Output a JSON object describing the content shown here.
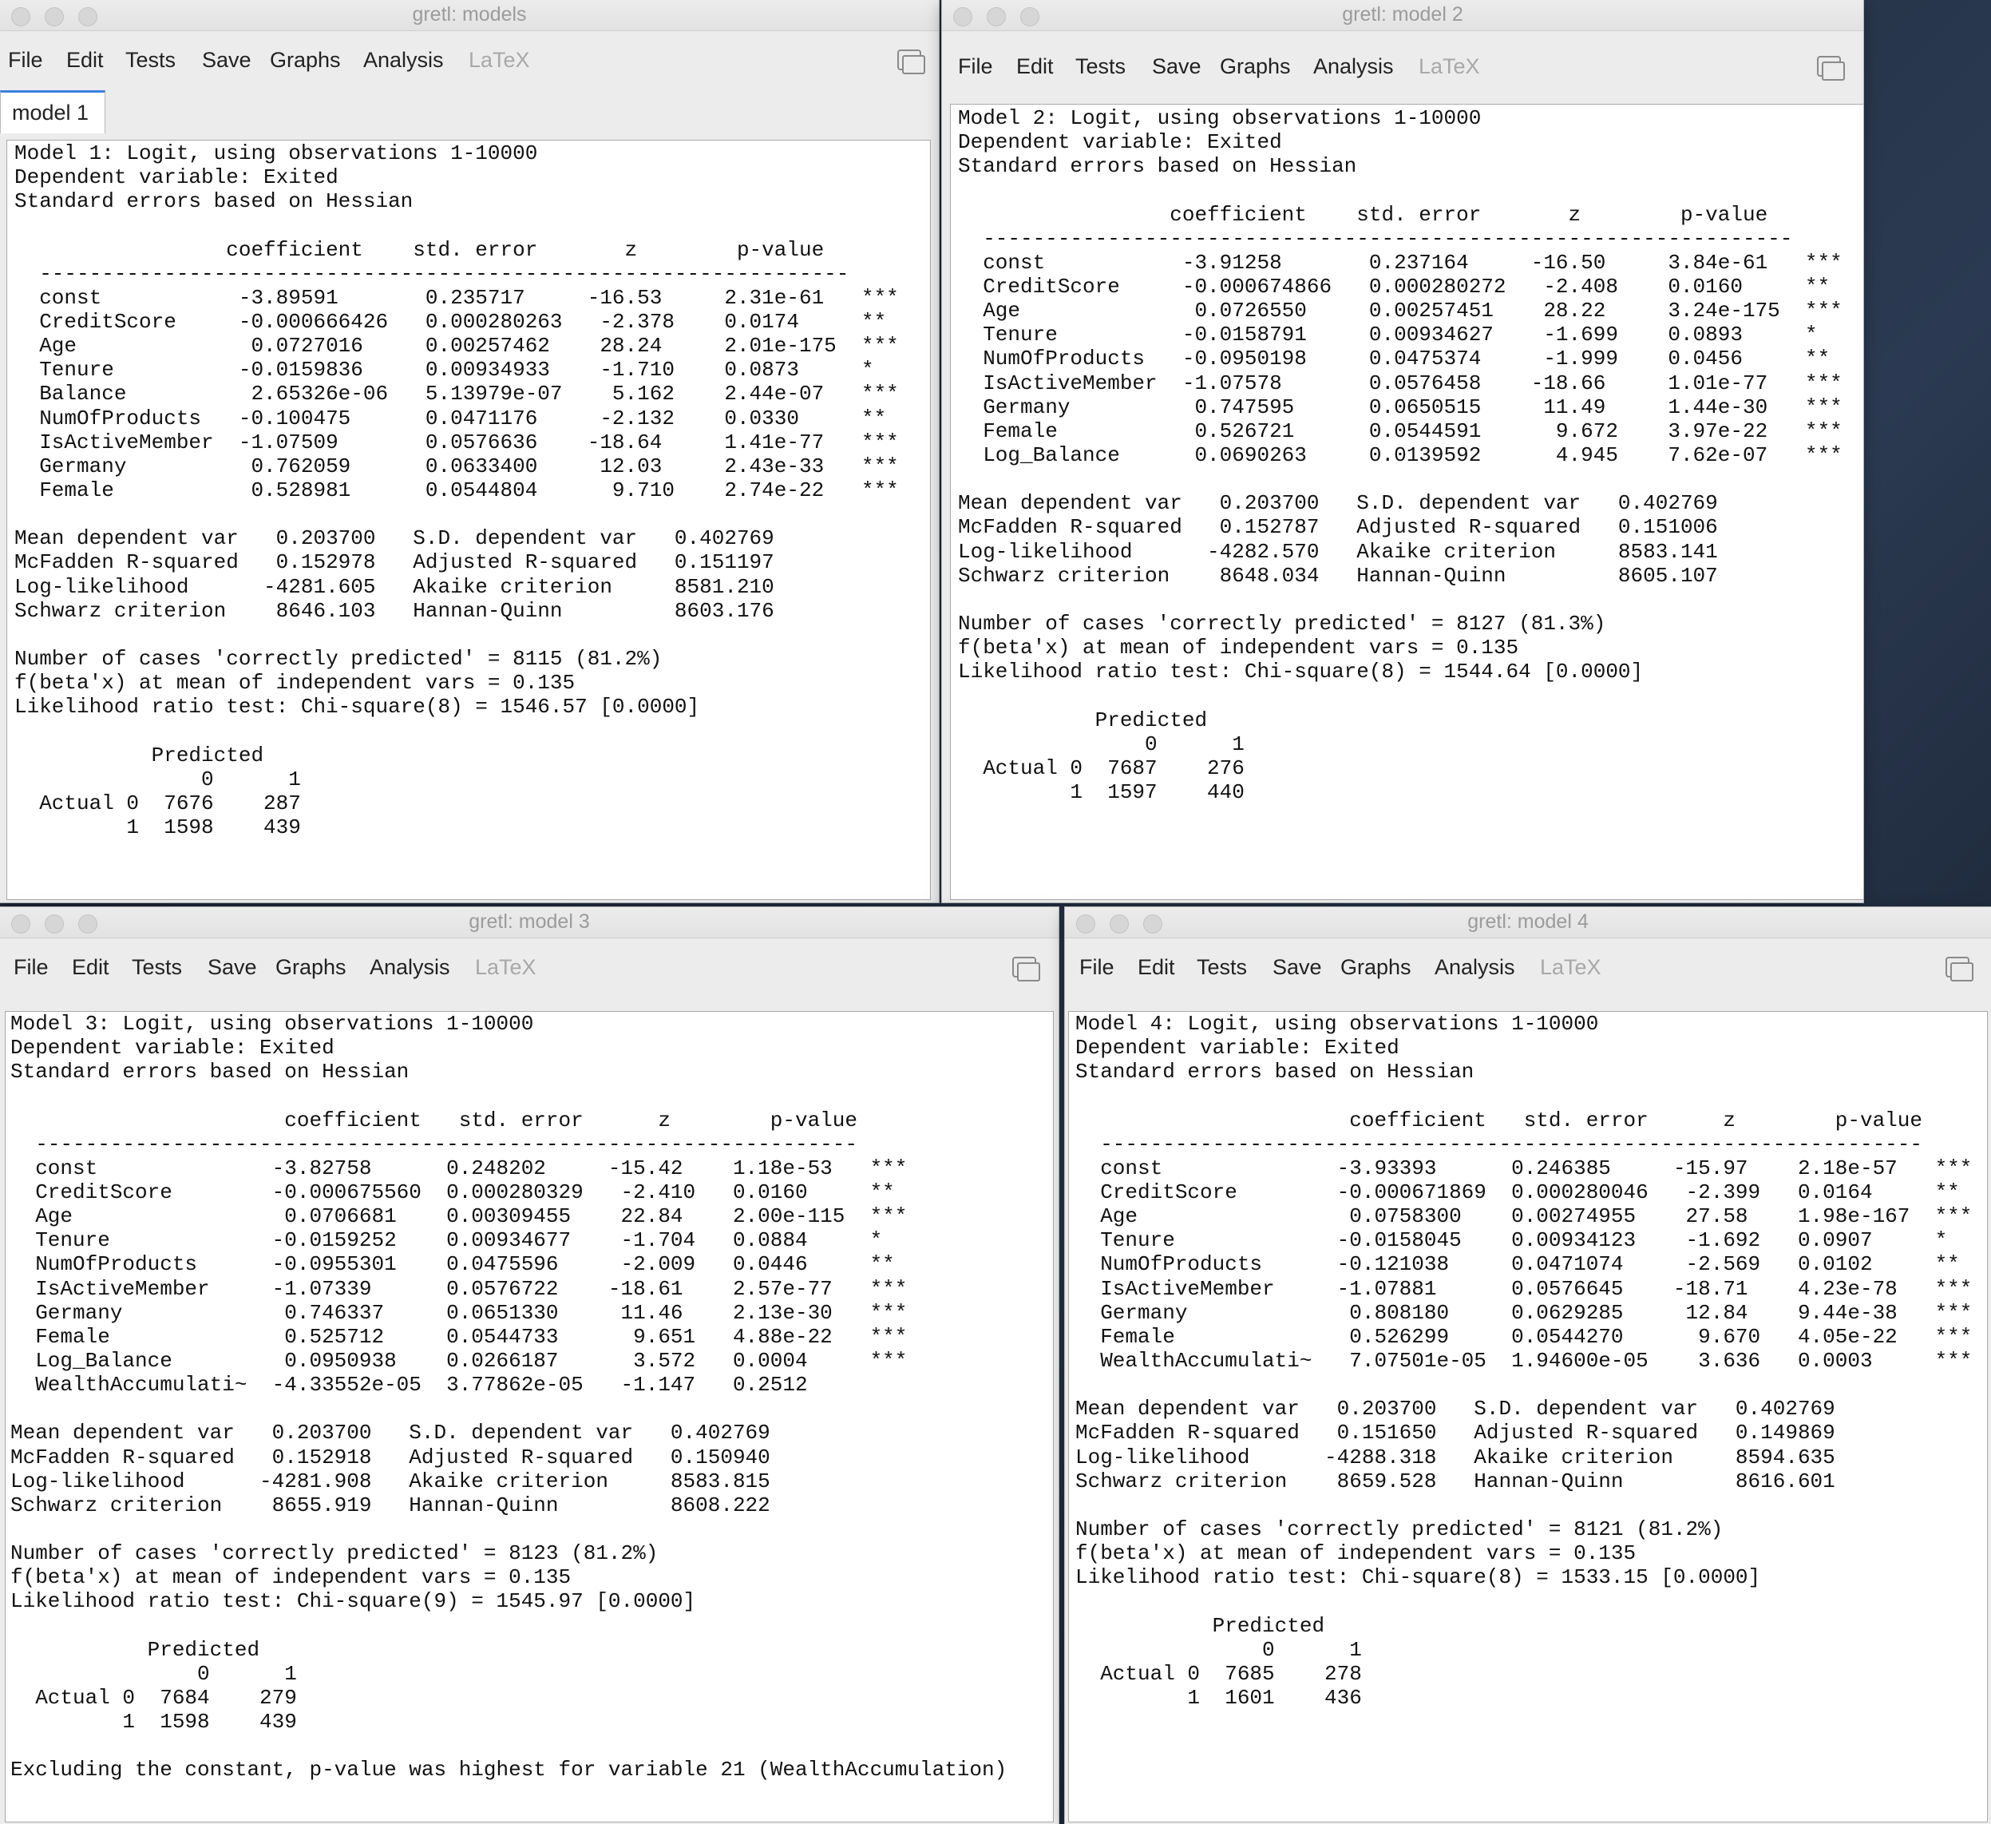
{
  "windows": [
    {
      "title": "gretl: models",
      "menu": [
        "File",
        "Edit",
        "Tests",
        "Save",
        "Graphs",
        "Analysis",
        "LaTeX"
      ],
      "tab": "model 1",
      "lines": [
        "Model 1: Logit, using observations 1-10000",
        "Dependent variable: Exited",
        "Standard errors based on Hessian",
        "",
        "                 coefficient    std. error       z        p-value",
        "  -----------------------------------------------------------------",
        "  const           -3.89591       0.235717     -16.53     2.31e-61   ***",
        "  CreditScore     -0.000666426   0.000280263   -2.378    0.0174     **",
        "  Age              0.0727016     0.00257462    28.24     2.01e-175  ***",
        "  Tenure          -0.0159836     0.00934933    -1.710    0.0873     *",
        "  Balance          2.65326e-06   5.13979e-07    5.162    2.44e-07   ***",
        "  NumOfProducts   -0.100475      0.0471176     -2.132    0.0330     **",
        "  IsActiveMember  -1.07509       0.0576636    -18.64     1.41e-77   ***",
        "  Germany          0.762059      0.0633400     12.03     2.43e-33   ***",
        "  Female           0.528981      0.0544804      9.710    2.74e-22   ***",
        "",
        "Mean dependent var   0.203700   S.D. dependent var   0.402769",
        "McFadden R-squared   0.152978   Adjusted R-squared   0.151197",
        "Log-likelihood      -4281.605   Akaike criterion     8581.210",
        "Schwarz criterion    8646.103   Hannan-Quinn         8603.176",
        "",
        "Number of cases 'correctly predicted' = 8115 (81.2%)",
        "f(beta'x) at mean of independent vars = 0.135",
        "Likelihood ratio test: Chi-square(8) = 1546.57 [0.0000]",
        "",
        "           Predicted",
        "               0      1",
        "  Actual 0  7676    287",
        "         1  1598    439"
      ]
    },
    {
      "title": "gretl: model 2",
      "menu": [
        "File",
        "Edit",
        "Tests",
        "Save",
        "Graphs",
        "Analysis",
        "LaTeX"
      ],
      "lines": [
        "Model 2: Logit, using observations 1-10000",
        "Dependent variable: Exited",
        "Standard errors based on Hessian",
        "",
        "                 coefficient    std. error       z        p-value",
        "  -----------------------------------------------------------------",
        "  const           -3.91258       0.237164     -16.50     3.84e-61   ***",
        "  CreditScore     -0.000674866   0.000280272   -2.408    0.0160     **",
        "  Age              0.0726550     0.00257451    28.22     3.24e-175  ***",
        "  Tenure          -0.0158791     0.00934627    -1.699    0.0893     *",
        "  NumOfProducts   -0.0950198     0.0475374     -1.999    0.0456     **",
        "  IsActiveMember  -1.07578       0.0576458    -18.66     1.01e-77   ***",
        "  Germany          0.747595      0.0650515     11.49     1.44e-30   ***",
        "  Female           0.526721      0.0544591      9.672    3.97e-22   ***",
        "  Log_Balance      0.0690263     0.0139592      4.945    7.62e-07   ***",
        "",
        "Mean dependent var   0.203700   S.D. dependent var   0.402769",
        "McFadden R-squared   0.152787   Adjusted R-squared   0.151006",
        "Log-likelihood      -4282.570   Akaike criterion     8583.141",
        "Schwarz criterion    8648.034   Hannan-Quinn         8605.107",
        "",
        "Number of cases 'correctly predicted' = 8127 (81.3%)",
        "f(beta'x) at mean of independent vars = 0.135",
        "Likelihood ratio test: Chi-square(8) = 1544.64 [0.0000]",
        "",
        "           Predicted",
        "               0      1",
        "  Actual 0  7687    276",
        "         1  1597    440"
      ]
    },
    {
      "title": "gretl: model 3",
      "menu": [
        "File",
        "Edit",
        "Tests",
        "Save",
        "Graphs",
        "Analysis",
        "LaTeX"
      ],
      "lines": [
        "Model 3: Logit, using observations 1-10000",
        "Dependent variable: Exited",
        "Standard errors based on Hessian",
        "",
        "                      coefficient   std. error      z        p-value",
        "  ------------------------------------------------------------------",
        "  const              -3.82758      0.248202     -15.42    1.18e-53   ***",
        "  CreditScore        -0.000675560  0.000280329   -2.410   0.0160     **",
        "  Age                 0.0706681    0.00309455    22.84    2.00e-115  ***",
        "  Tenure             -0.0159252    0.00934677    -1.704   0.0884     *",
        "  NumOfProducts      -0.0955301    0.0475596     -2.009   0.0446     **",
        "  IsActiveMember     -1.07339      0.0576722    -18.61    2.57e-77   ***",
        "  Germany             0.746337     0.0651330     11.46    2.13e-30   ***",
        "  Female              0.525712     0.0544733      9.651   4.88e-22   ***",
        "  Log_Balance         0.0950938    0.0266187      3.572   0.0004     ***",
        "  WealthAccumulati~  -4.33552e-05  3.77862e-05   -1.147   0.2512",
        "",
        "Mean dependent var   0.203700   S.D. dependent var   0.402769",
        "McFadden R-squared   0.152918   Adjusted R-squared   0.150940",
        "Log-likelihood      -4281.908   Akaike criterion     8583.815",
        "Schwarz criterion    8655.919   Hannan-Quinn         8608.222",
        "",
        "Number of cases 'correctly predicted' = 8123 (81.2%)",
        "f(beta'x) at mean of independent vars = 0.135",
        "Likelihood ratio test: Chi-square(9) = 1545.97 [0.0000]",
        "",
        "           Predicted",
        "               0      1",
        "  Actual 0  7684    279",
        "         1  1598    439",
        "",
        "Excluding the constant, p-value was highest for variable 21 (WealthAccumulation)"
      ]
    },
    {
      "title": "gretl: model 4",
      "menu": [
        "File",
        "Edit",
        "Tests",
        "Save",
        "Graphs",
        "Analysis",
        "LaTeX"
      ],
      "lines": [
        "Model 4: Logit, using observations 1-10000",
        "Dependent variable: Exited",
        "Standard errors based on Hessian",
        "",
        "                      coefficient   std. error      z        p-value",
        "  ------------------------------------------------------------------",
        "  const              -3.93393      0.246385     -15.97    2.18e-57   ***",
        "  CreditScore        -0.000671869  0.000280046   -2.399   0.0164     **",
        "  Age                 0.0758300    0.00274955    27.58    1.98e-167  ***",
        "  Tenure             -0.0158045    0.00934123    -1.692   0.0907     *",
        "  NumOfProducts      -0.121038     0.0471074     -2.569   0.0102     **",
        "  IsActiveMember     -1.07881      0.0576645    -18.71    4.23e-78   ***",
        "  Germany             0.808180     0.0629285     12.84    9.44e-38   ***",
        "  Female              0.526299     0.0544270      9.670   4.05e-22   ***",
        "  WealthAccumulati~   7.07501e-05  1.94600e-05    3.636   0.0003     ***",
        "",
        "Mean dependent var   0.203700   S.D. dependent var   0.402769",
        "McFadden R-squared   0.151650   Adjusted R-squared   0.149869",
        "Log-likelihood      -4288.318   Akaike criterion     8594.635",
        "Schwarz criterion    8659.528   Hannan-Quinn         8616.601",
        "",
        "Number of cases 'correctly predicted' = 8121 (81.2%)",
        "f(beta'x) at mean of independent vars = 0.135",
        "Likelihood ratio test: Chi-square(8) = 1533.15 [0.0000]",
        "",
        "           Predicted",
        "               0      1",
        "  Actual 0  7685    278",
        "         1  1601    436"
      ]
    }
  ]
}
